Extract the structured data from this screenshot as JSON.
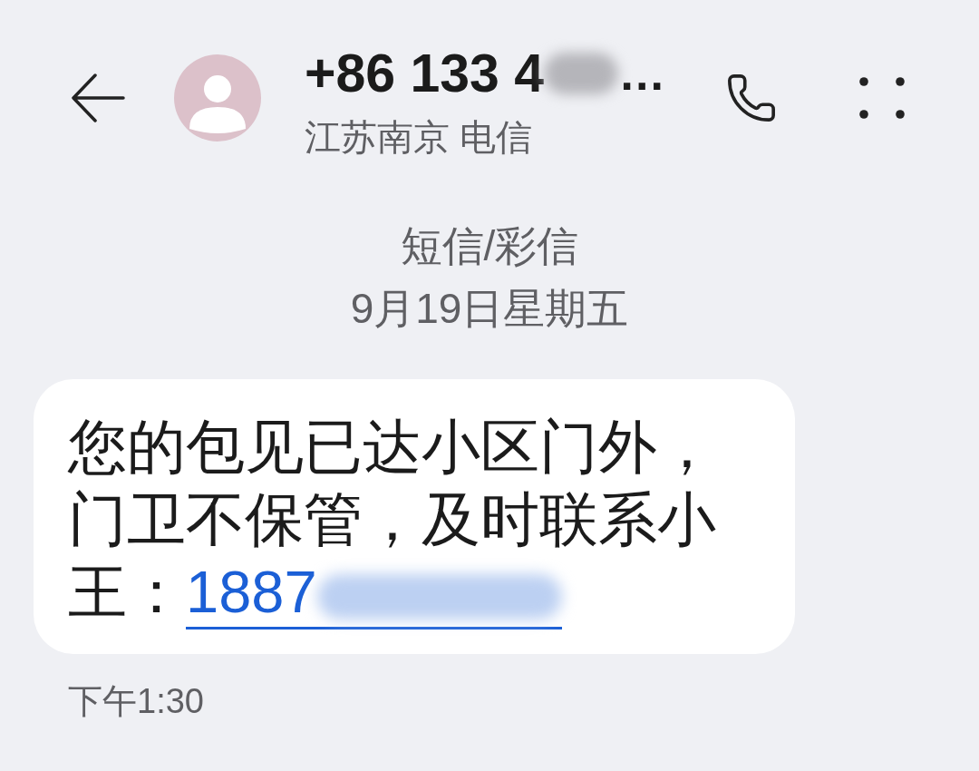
{
  "contact": {
    "number": "+86 133 4",
    "number_redacted": true,
    "truncation": "…",
    "location": "江苏南京 电信"
  },
  "thread": {
    "type": "短信/彩信",
    "date": "9月19日星期五"
  },
  "messages": [
    {
      "kind": "received",
      "text": "您的包见已达小区门外，门卫不保管，及时联系小王：",
      "link": {
        "text": "1887",
        "redacted": true
      },
      "time": "下午1:30"
    }
  ]
}
